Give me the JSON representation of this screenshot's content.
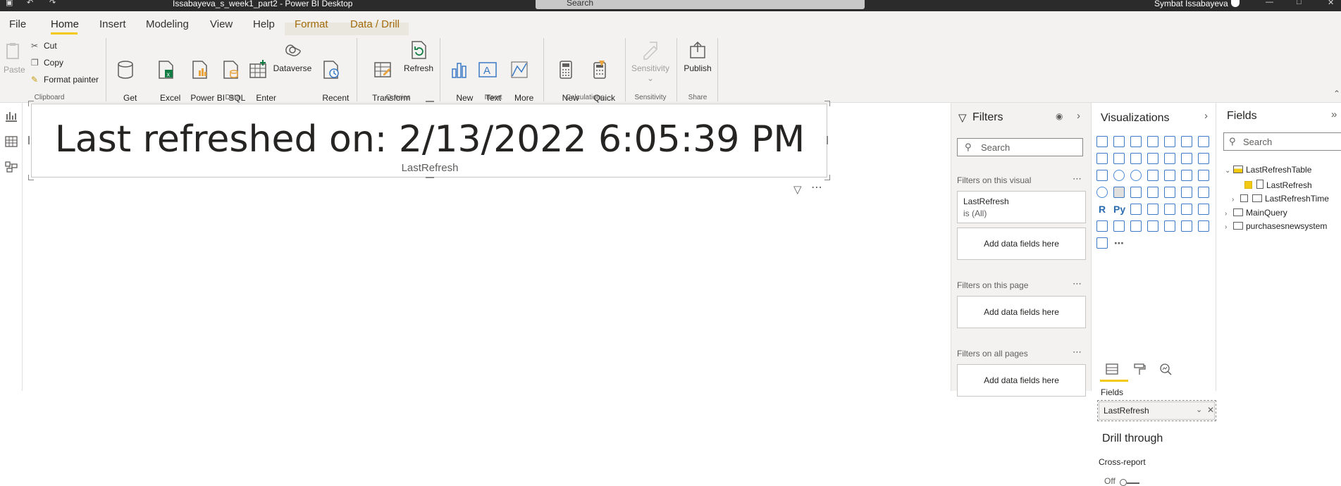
{
  "titlebar": {
    "document_title": "Issabayeva_s_week1_part2 - Power BI Desktop",
    "search_placeholder": "Search",
    "user_name": "Symbat Issabayeva"
  },
  "tabs": [
    "File",
    "Home",
    "Insert",
    "Modeling",
    "View",
    "Help",
    "Format",
    "Data / Drill"
  ],
  "active_tab": "Home",
  "ribbon": {
    "clipboard": {
      "paste": "Paste",
      "cut": "Cut",
      "copy": "Copy",
      "format_painter": "Format painter",
      "group": "Clipboard"
    },
    "data": {
      "get_data": "Get\ndata",
      "excel": "Excel\nworkbook",
      "pbi_datasets": "Power BI\ndatasets",
      "sql": "SQL\nServer",
      "enter_data": "Enter\ndata",
      "dataverse": "Dataverse",
      "recent": "Recent\nsources",
      "group": "Data"
    },
    "queries": {
      "transform": "Transform\ndata",
      "refresh": "Refresh",
      "group": "Queries"
    },
    "insert": {
      "new_visual": "New\nvisual",
      "text_box": "Text\nbox",
      "more_visuals": "More\nvisuals",
      "group": "Insert"
    },
    "calculations": {
      "new_measure": "New\nmeasure",
      "quick_measure": "Quick\nmeasure",
      "group": "Calculations"
    },
    "sensitivity": {
      "label": "Sensitivity",
      "group": "Sensitivity"
    },
    "share": {
      "publish": "Publish",
      "group": "Share"
    }
  },
  "card": {
    "value": "Last refreshed on: 2/13/2022 6:05:39 PM",
    "label": "LastRefresh"
  },
  "filters": {
    "title": "Filters",
    "search_placeholder": "Search",
    "on_visual": "Filters on this visual",
    "visual_filter_field": "LastRefresh",
    "visual_filter_state": "is (All)",
    "add_fields": "Add data fields here",
    "on_page": "Filters on this page",
    "on_all_pages": "Filters on all pages"
  },
  "visualizations": {
    "title": "Visualizations",
    "fields_label": "Fields",
    "well_value": "LastRefresh",
    "drill_through": "Drill through",
    "cross_report": "Cross-report",
    "toggle_state": "Off",
    "letter_icons": [
      "R",
      "Py"
    ]
  },
  "fields": {
    "title": "Fields",
    "search_placeholder": "Search",
    "tables": [
      {
        "name": "LastRefreshTable",
        "expanded": true,
        "columns": [
          {
            "name": "LastRefresh",
            "checked": true
          },
          {
            "name": "LastRefreshTime",
            "checked": false
          }
        ]
      },
      {
        "name": "MainQuery",
        "expanded": false
      },
      {
        "name": "purchasesnewsystem",
        "expanded": false
      }
    ]
  },
  "colors": {
    "accent": "#f2c811",
    "format_tab": "#a36b0b",
    "titlebar": "#2b2b2b",
    "icon_blue": "#3b7ac4"
  }
}
